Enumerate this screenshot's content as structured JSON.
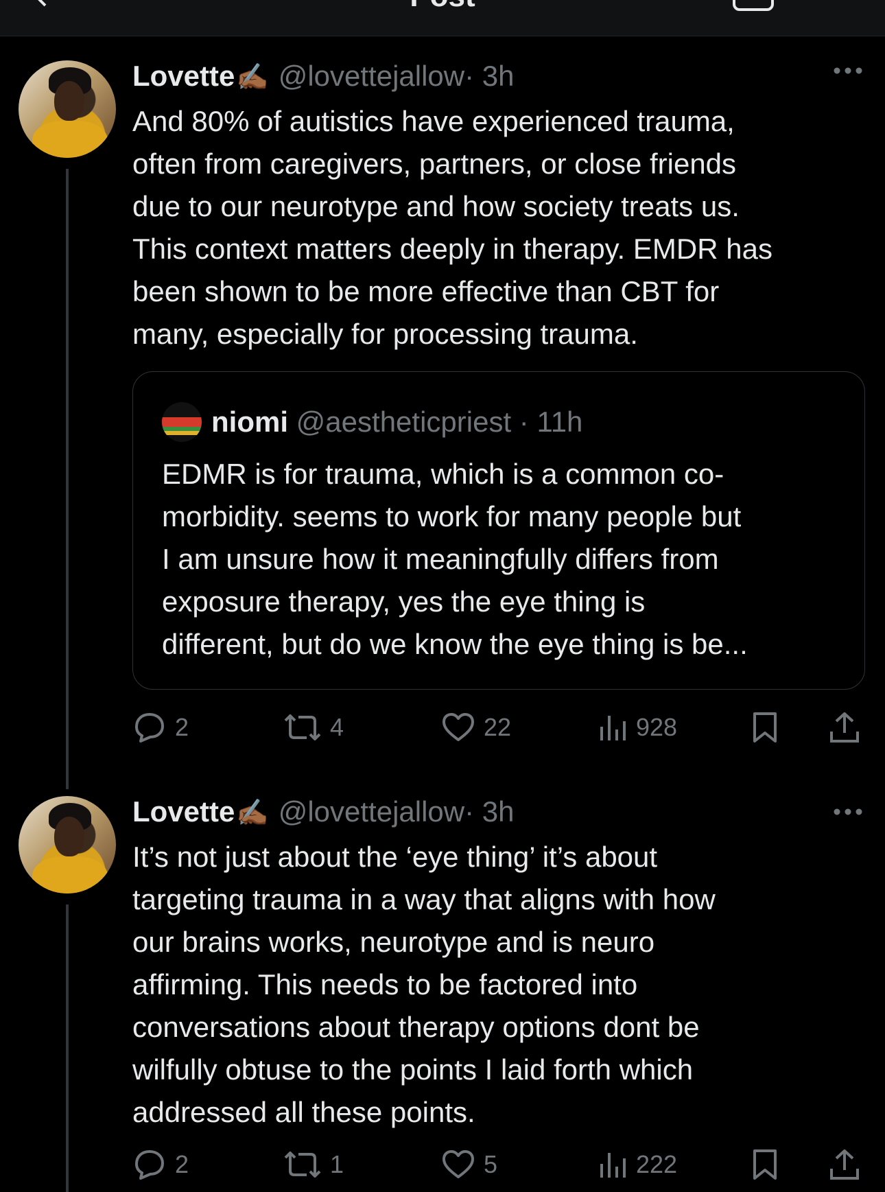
{
  "topbar": {
    "title": "Post"
  },
  "posts": [
    {
      "name": "Lovette",
      "emoji": "✍🏾",
      "handle": "@lovettejallow",
      "time": "· 3h",
      "text": "And 80% of autistics have experienced trauma,\noften from caregivers, partners, or close friends\ndue to our neurotype and how society treats us.\nThis context matters deeply in therapy. EMDR has\nbeen shown to be more effective than CBT for\nmany, especially for processing trauma.",
      "quote": {
        "name": "niomi",
        "handle": "@aestheticpriest",
        "time": "· 11h",
        "text": "EDMR is for trauma, which is a common co-\nmorbidity. seems to work for many people but\nI am unsure how it meaningfully differs from\nexposure therapy, yes the eye thing is\ndifferent, but do we know the eye thing is be..."
      },
      "stats": {
        "replies": "2",
        "reposts": "4",
        "likes": "22",
        "views": "928"
      }
    },
    {
      "name": "Lovette",
      "emoji": "✍🏾",
      "handle": "@lovettejallow",
      "time": "· 3h",
      "text": "It’s not just about the ‘eye thing’ it’s about\ntargeting trauma in a way that aligns with how\nour brains works, neurotype and is neuro\naffirming. This needs to be factored into\nconversations about therapy options dont be\nwilfully obtuse to the points I laid forth which\naddressed all these points.",
      "stats": {
        "replies": "2",
        "reposts": "1",
        "likes": "5",
        "views": "222"
      }
    }
  ]
}
